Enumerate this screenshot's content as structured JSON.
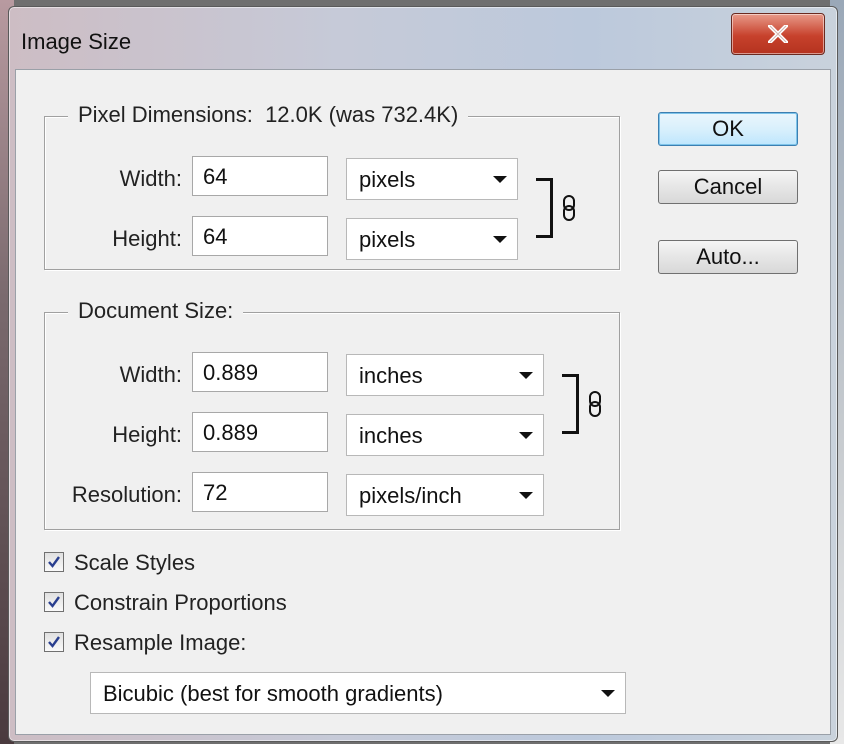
{
  "window": {
    "title": "Image Size"
  },
  "pixel_dimensions": {
    "legend": "Pixel Dimensions:  12.0K (was 732.4K)",
    "width": {
      "label": "Width:",
      "value": "64",
      "unit": "pixels"
    },
    "height": {
      "label": "Height:",
      "value": "64",
      "unit": "pixels"
    }
  },
  "document_size": {
    "legend": "Document Size:",
    "width": {
      "label": "Width:",
      "value": "0.889",
      "unit": "inches"
    },
    "height": {
      "label": "Height:",
      "value": "0.889",
      "unit": "inches"
    },
    "resolution": {
      "label": "Resolution:",
      "value": "72",
      "unit": "pixels/inch"
    }
  },
  "buttons": {
    "ok": "OK",
    "cancel": "Cancel",
    "auto": "Auto..."
  },
  "options": {
    "scale_styles": {
      "label": "Scale Styles",
      "checked": true
    },
    "constrain_proportions": {
      "label": "Constrain Proportions",
      "checked": true
    },
    "resample_image": {
      "label": "Resample Image:",
      "checked": true
    },
    "resample_method": "Bicubic (best for smooth gradients)"
  },
  "icons": {
    "close": "close-icon",
    "link": "chain-link-icon",
    "checkmark": "checkmark-icon",
    "dropdown": "chevron-down-icon"
  },
  "colors": {
    "close_button": "#c7412c",
    "default_button_border": "#3c7fb1",
    "dialog_bg": "#f0f0f0"
  }
}
